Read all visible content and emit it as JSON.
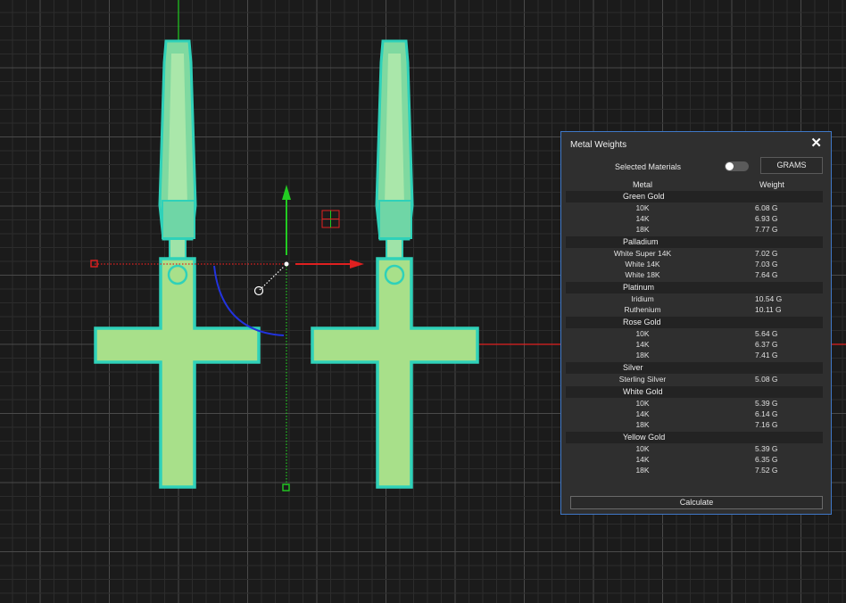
{
  "panel": {
    "title": "Metal Weights",
    "close_glyph": "✕",
    "selected_materials_label": "Selected Materials",
    "toggle_on": false,
    "unit_button": "GRAMS",
    "col_metal": "Metal",
    "col_weight": "Weight",
    "calculate_label": "Calculate",
    "groups": [
      {
        "name": "Green Gold",
        "rows": [
          {
            "metal": "10K",
            "weight": "6.08 G"
          },
          {
            "metal": "14K",
            "weight": "6.93 G"
          },
          {
            "metal": "18K",
            "weight": "7.77 G"
          }
        ]
      },
      {
        "name": "Palladium",
        "rows": [
          {
            "metal": "White Super 14K",
            "weight": "7.02 G"
          },
          {
            "metal": "White 14K",
            "weight": "7.03 G"
          },
          {
            "metal": "White 18K",
            "weight": "7.64 G"
          }
        ]
      },
      {
        "name": "Platinum",
        "rows": [
          {
            "metal": "Iridium",
            "weight": "10.54 G"
          },
          {
            "metal": "Ruthenium",
            "weight": "10.11 G"
          }
        ]
      },
      {
        "name": "Rose Gold",
        "rows": [
          {
            "metal": "10K",
            "weight": "5.64 G"
          },
          {
            "metal": "14K",
            "weight": "6.37 G"
          },
          {
            "metal": "18K",
            "weight": "7.41 G"
          }
        ]
      },
      {
        "name": "Silver",
        "rows": [
          {
            "metal": "Sterling Silver",
            "weight": "5.08 G"
          }
        ]
      },
      {
        "name": "White Gold",
        "rows": [
          {
            "metal": "10K",
            "weight": "5.39 G"
          },
          {
            "metal": "14K",
            "weight": "6.14 G"
          },
          {
            "metal": "18K",
            "weight": "7.16 G"
          }
        ]
      },
      {
        "name": "Yellow Gold",
        "rows": [
          {
            "metal": "10K",
            "weight": "5.39 G"
          },
          {
            "metal": "14K",
            "weight": "6.35 G"
          },
          {
            "metal": "18K",
            "weight": "7.52 G"
          }
        ]
      }
    ]
  },
  "colors": {
    "viewport_bg": "#1b1b1b",
    "grid_minor": "#2c2c2c",
    "grid_major": "#4a4a4a",
    "model_fill": "#a8e08a",
    "model_edge": "#2fd1b9",
    "axis_x": "#e02020",
    "axis_y": "#22cc22",
    "rotate_arc": "#2233dd",
    "panel_bg": "#2f2f2f",
    "panel_border": "#3f78c8"
  },
  "icons": {
    "close": "close-icon",
    "toggle": "toggle-switch-icon",
    "gizmo_move_x": "arrow-right-icon",
    "gizmo_move_y": "arrow-up-icon",
    "gizmo_plane": "plane-handle-icon",
    "gizmo_rotate": "rotate-arc-icon"
  }
}
